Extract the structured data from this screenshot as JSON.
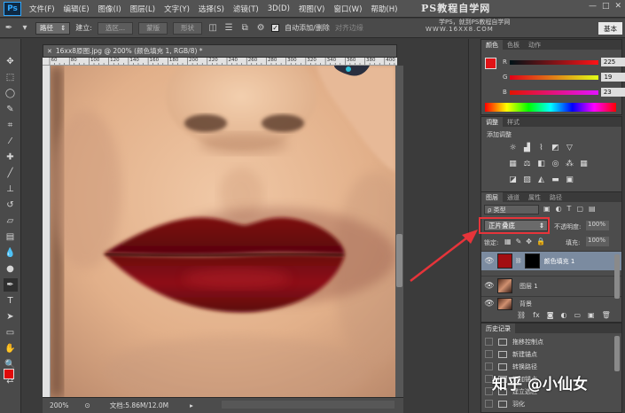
{
  "app": {
    "logo": "Ps",
    "menu": [
      "文件(F)",
      "编辑(E)",
      "图像(I)",
      "图层(L)",
      "文字(Y)",
      "选择(S)",
      "滤镜(T)",
      "3D(D)",
      "视图(V)",
      "窗口(W)",
      "帮助(H)"
    ],
    "brand": "PS教程自学网",
    "slogan": "学PS，就到PS教程自学网",
    "site_url": "WWW.16XX8.COM",
    "window_controls": [
      "—",
      "□",
      "✕"
    ]
  },
  "options": {
    "mode_select": "路径",
    "build_label": "建立:",
    "select_btn": "选区...",
    "mask_btn": "蒙版",
    "shape_btn": "形状",
    "auto_add_label": "自动添加/删除",
    "align_edges_label": "对齐边缘",
    "workspace": "基本"
  },
  "document": {
    "tab_title": "16xx8原图.jpg @ 200% (颜色填充 1, RGB/8) *",
    "zoom": "200%",
    "doc_info": "文档:5.86M/12.0M",
    "ruler_ticks": [
      "60",
      "80",
      "100",
      "120",
      "140",
      "160",
      "180",
      "200",
      "220",
      "240",
      "260",
      "280",
      "300",
      "320",
      "340",
      "360",
      "380",
      "400"
    ]
  },
  "color_panel": {
    "tabs": [
      "颜色",
      "色板",
      "动作"
    ],
    "r": {
      "label": "R",
      "value": "225"
    },
    "g": {
      "label": "G",
      "value": "19"
    },
    "b": {
      "label": "B",
      "value": "23"
    },
    "fg_hex": "#e11317"
  },
  "adjust_panel": {
    "tabs": [
      "调整",
      "样式"
    ],
    "title": "添加调整"
  },
  "layers_panel": {
    "tabs": [
      "图层",
      "通道",
      "属性",
      "路径"
    ],
    "kind_filter": "ρ 类型",
    "blend_mode": "正片叠底",
    "opacity_label": "不透明度:",
    "opacity_value": "100%",
    "lock_label": "锁定:",
    "fill_label": "填充:",
    "fill_value": "100%",
    "layers": [
      {
        "name": "颜色填充 1",
        "selected": true
      },
      {
        "name": "图层 1",
        "selected": false
      },
      {
        "name": "背景",
        "selected": false
      }
    ]
  },
  "history_panel": {
    "tabs": [
      "历史记录"
    ],
    "items": [
      "拖移控制点",
      "新建锚点",
      "转换路径",
      "添加锚点",
      "建立选区",
      "羽化"
    ]
  },
  "watermark": "知乎 @小仙女"
}
